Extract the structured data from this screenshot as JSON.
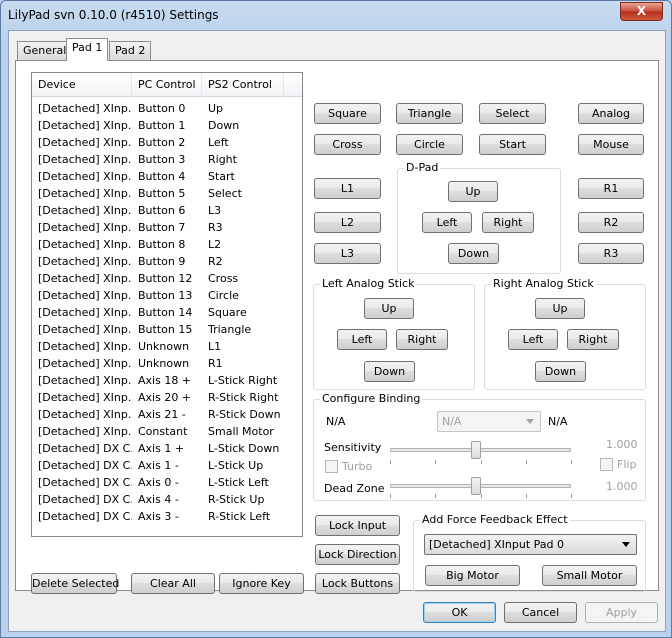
{
  "window": {
    "title": "LilyPad svn 0.10.0 (r4510) Settings",
    "close_glyph": "X"
  },
  "tabs": [
    "General",
    "Pad 1",
    "Pad 2"
  ],
  "list": {
    "columns": [
      "Device",
      "PC Control",
      "PS2 Control"
    ],
    "rows": [
      [
        "[Detached] XInp...",
        "Button 0",
        "Up"
      ],
      [
        "[Detached] XInp...",
        "Button 1",
        "Down"
      ],
      [
        "[Detached] XInp...",
        "Button 2",
        "Left"
      ],
      [
        "[Detached] XInp...",
        "Button 3",
        "Right"
      ],
      [
        "[Detached] XInp...",
        "Button 4",
        "Start"
      ],
      [
        "[Detached] XInp...",
        "Button 5",
        "Select"
      ],
      [
        "[Detached] XInp...",
        "Button 6",
        "L3"
      ],
      [
        "[Detached] XInp...",
        "Button 7",
        "R3"
      ],
      [
        "[Detached] XInp...",
        "Button 8",
        "L2"
      ],
      [
        "[Detached] XInp...",
        "Button 9",
        "R2"
      ],
      [
        "[Detached] XInp...",
        "Button 12",
        "Cross"
      ],
      [
        "[Detached] XInp...",
        "Button 13",
        "Circle"
      ],
      [
        "[Detached] XInp...",
        "Button 14",
        "Square"
      ],
      [
        "[Detached] XInp...",
        "Button 15",
        "Triangle"
      ],
      [
        "[Detached] XInp...",
        "Unknown",
        "L1"
      ],
      [
        "[Detached] XInp...",
        "Unknown",
        "R1"
      ],
      [
        "[Detached] XInp...",
        "Axis 18 +",
        "L-Stick Right"
      ],
      [
        "[Detached] XInp...",
        "Axis 20 +",
        "R-Stick Right"
      ],
      [
        "[Detached] XInp...",
        "Axis 21 -",
        "R-Stick Down"
      ],
      [
        "[Detached] XInp...",
        "Constant",
        "Small Motor"
      ],
      [
        "[Detached] DX C...",
        "Axis 1 +",
        "L-Stick Down"
      ],
      [
        "[Detached] DX C...",
        "Axis 1 -",
        "L-Stick Up"
      ],
      [
        "[Detached] DX C...",
        "Axis 0 -",
        "L-Stick Left"
      ],
      [
        "[Detached] DX C...",
        "Axis 4 -",
        "R-Stick Up"
      ],
      [
        "[Detached] DX C...",
        "Axis 3 -",
        "R-Stick Left"
      ]
    ]
  },
  "list_buttons": {
    "delete_selected": "Delete Selected",
    "clear_all": "Clear All",
    "ignore_key": "Ignore Key"
  },
  "pad_buttons": {
    "square": "Square",
    "triangle": "Triangle",
    "select": "Select",
    "analog": "Analog",
    "cross": "Cross",
    "circle": "Circle",
    "start": "Start",
    "mouse": "Mouse",
    "l1": "L1",
    "l2": "L2",
    "l3": "L3",
    "r1": "R1",
    "r2": "R2",
    "r3": "R3"
  },
  "dpad": {
    "label": "D-Pad",
    "up": "Up",
    "left": "Left",
    "right": "Right",
    "down": "Down"
  },
  "left_stick": {
    "label": "Left Analog Stick",
    "up": "Up",
    "left": "Left",
    "right": "Right",
    "down": "Down"
  },
  "right_stick": {
    "label": "Right Analog Stick",
    "up": "Up",
    "left": "Left",
    "right": "Right",
    "down": "Down"
  },
  "configure": {
    "label": "Configure Binding",
    "left_value": "N/A",
    "combo_value": "N/A",
    "right_value": "N/A",
    "sensitivity_label": "Sensitivity",
    "sensitivity_value": "1.000",
    "sensitivity_level": 0.45,
    "turbo_label": "Turbo",
    "flip_label": "Flip",
    "deadzone_label": "Dead Zone",
    "deadzone_value": "1.000",
    "deadzone_level": 0.45
  },
  "lock_buttons": {
    "lock_input": "Lock Input",
    "lock_direction": "Lock Direction",
    "lock_buttons": "Lock Buttons"
  },
  "force_feedback": {
    "label": "Add Force Feedback Effect",
    "device": "[Detached] XInput Pad 0",
    "big_motor": "Big Motor",
    "small_motor": "Small Motor"
  },
  "dialog_buttons": {
    "ok": "OK",
    "cancel": "Cancel",
    "apply": "Apply"
  }
}
